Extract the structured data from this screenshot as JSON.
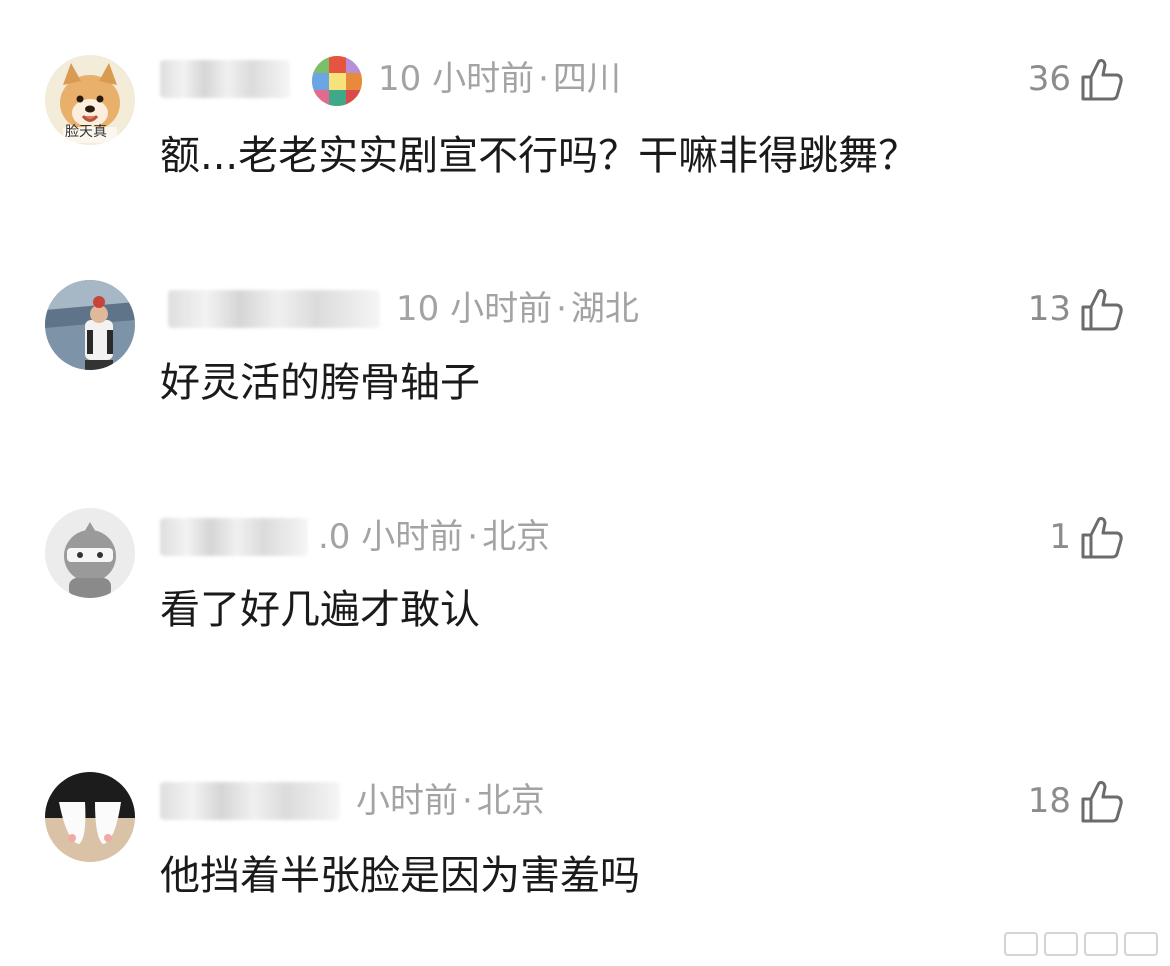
{
  "comments": [
    {
      "time": "10 小时前",
      "location": "四川",
      "likes": "36",
      "text": "额...老老实实剧宣不行吗？干嘛非得跳舞？",
      "avatar_label": "脸天真"
    },
    {
      "time": "10 小时前",
      "location": "湖北",
      "likes": "13",
      "text": "好灵活的胯骨轴子"
    },
    {
      "time": ".0 小时前",
      "location": "北京",
      "likes": "1",
      "text": "看了好几遍才敢认"
    },
    {
      "time": "小时前",
      "location": "北京",
      "likes": "18",
      "text": "他挡着半张脸是因为害羞吗"
    }
  ],
  "separator": "·",
  "colors": {
    "meta_text": "#a3a3a3",
    "content_text": "#1a1a1a",
    "like_count": "#8c8c8c"
  }
}
